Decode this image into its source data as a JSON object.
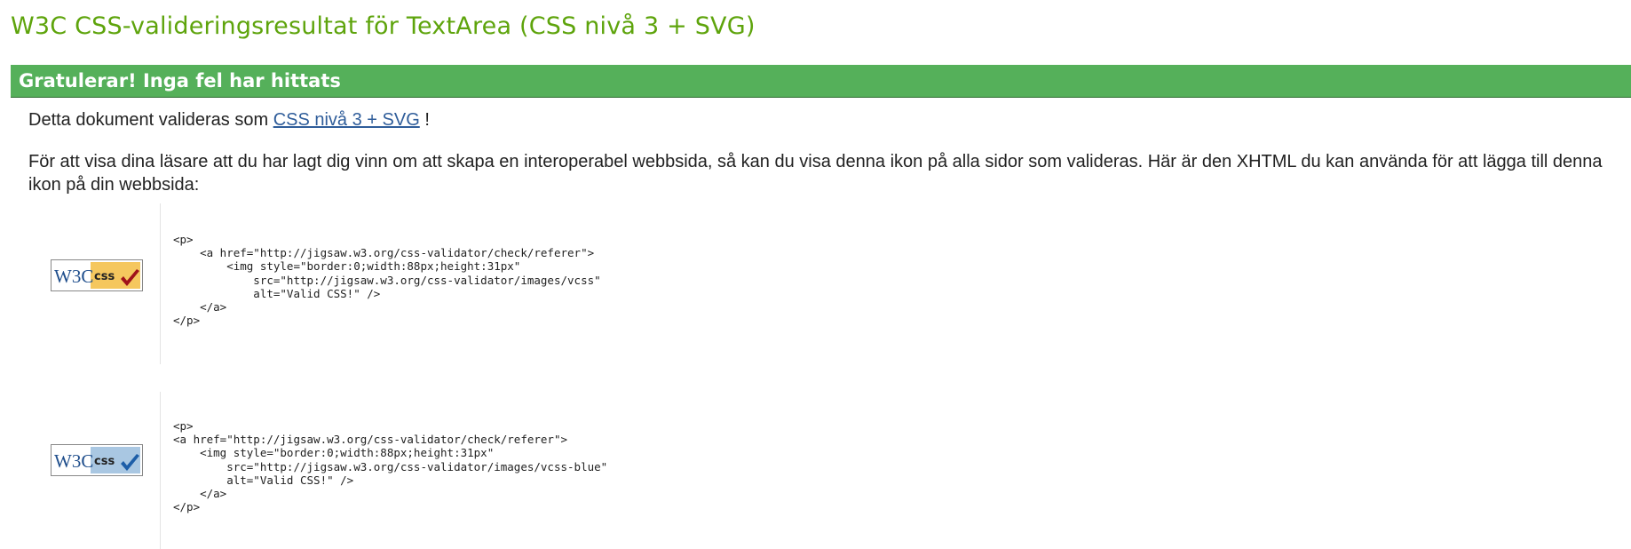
{
  "title": "W3C CSS-valideringsresultat för TextArea (CSS nivå 3 + SVG)",
  "banner": "Gratulerar! Inga fel har hittats",
  "intro": {
    "before": "Detta dokument valideras som ",
    "link": "CSS nivå 3 + SVG",
    "after": " !"
  },
  "description": "För att visa dina läsare att du har lagt dig vinn om att skapa en interoperabel webbsida, så kan du visa denna ikon på alla sidor som valideras. Här är den XHTML du kan använda för att lägga till denna ikon på din webbsida:",
  "badges": [
    {
      "alt": "Valid CSS!",
      "logo_text": "W3C",
      "label": "css",
      "bg_color": "#f5c75e",
      "check_color": "#a0121a",
      "code": "<p>\n    <a href=\"http://jigsaw.w3.org/css-validator/check/referer\">\n        <img style=\"border:0;width:88px;height:31px\"\n            src=\"http://jigsaw.w3.org/css-validator/images/vcss\"\n            alt=\"Valid CSS!\" />\n    </a>\n</p>"
    },
    {
      "alt": "Valid CSS!",
      "logo_text": "W3C",
      "label": "css",
      "bg_color": "#a9c7e2",
      "check_color": "#1d5ea8",
      "code": "<p>\n<a href=\"http://jigsaw.w3.org/css-validator/check/referer\">\n    <img style=\"border:0;width:88px;height:31px\"\n        src=\"http://jigsaw.w3.org/css-validator/images/vcss-blue\"\n        alt=\"Valid CSS!\" />\n    </a>\n</p>"
    }
  ]
}
